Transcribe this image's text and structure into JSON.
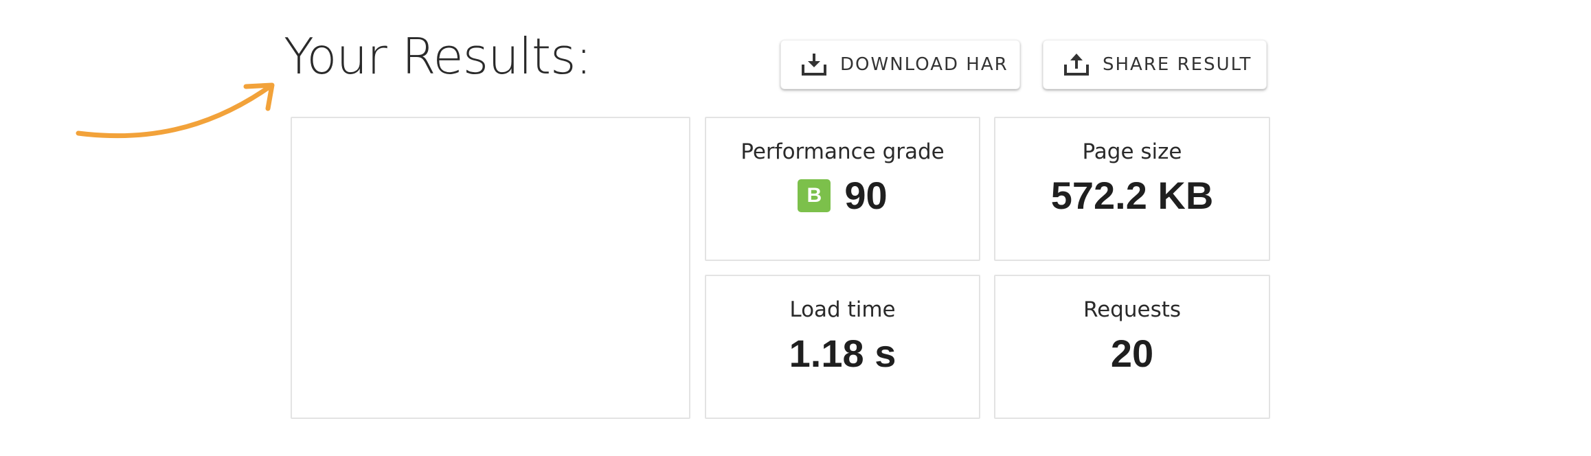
{
  "header": {
    "title": "Your Results:"
  },
  "toolbar": {
    "download_label": "DOWNLOAD HAR",
    "download_icon": "download-icon",
    "share_label": "SHARE RESULT",
    "share_icon": "share-icon"
  },
  "annotation": {
    "arrow_icon": "curved-arrow-icon",
    "arrow_color": "#F2A23A"
  },
  "metrics": {
    "performance": {
      "label": "Performance grade",
      "grade": "B",
      "grade_color": "#7CC04B",
      "value": "90"
    },
    "page_size": {
      "label": "Page size",
      "value": "572.2 KB"
    },
    "load_time": {
      "label": "Load time",
      "value": "1.18 s"
    },
    "requests": {
      "label": "Requests",
      "value": "20"
    }
  }
}
